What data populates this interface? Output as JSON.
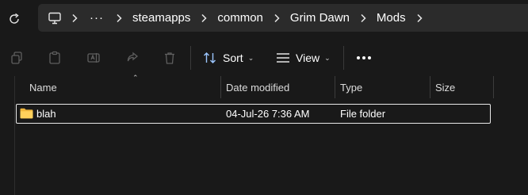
{
  "address": {
    "crumbs": [
      "steamapps",
      "common",
      "Grim Dawn",
      "Mods"
    ],
    "overflow": "···"
  },
  "toolbar": {
    "sort_label": "Sort",
    "view_label": "View",
    "more": "•••"
  },
  "columns": {
    "name": "Name",
    "date": "Date modified",
    "type": "Type",
    "size": "Size"
  },
  "files": [
    {
      "name": "blah",
      "date": "04-Jul-26 7:36 AM",
      "type": "File folder",
      "size": ""
    }
  ],
  "colors": {
    "accent": "#ffffff",
    "folder": "#f5c242",
    "background": "#191919",
    "address_bg": "#2b2b2b"
  }
}
